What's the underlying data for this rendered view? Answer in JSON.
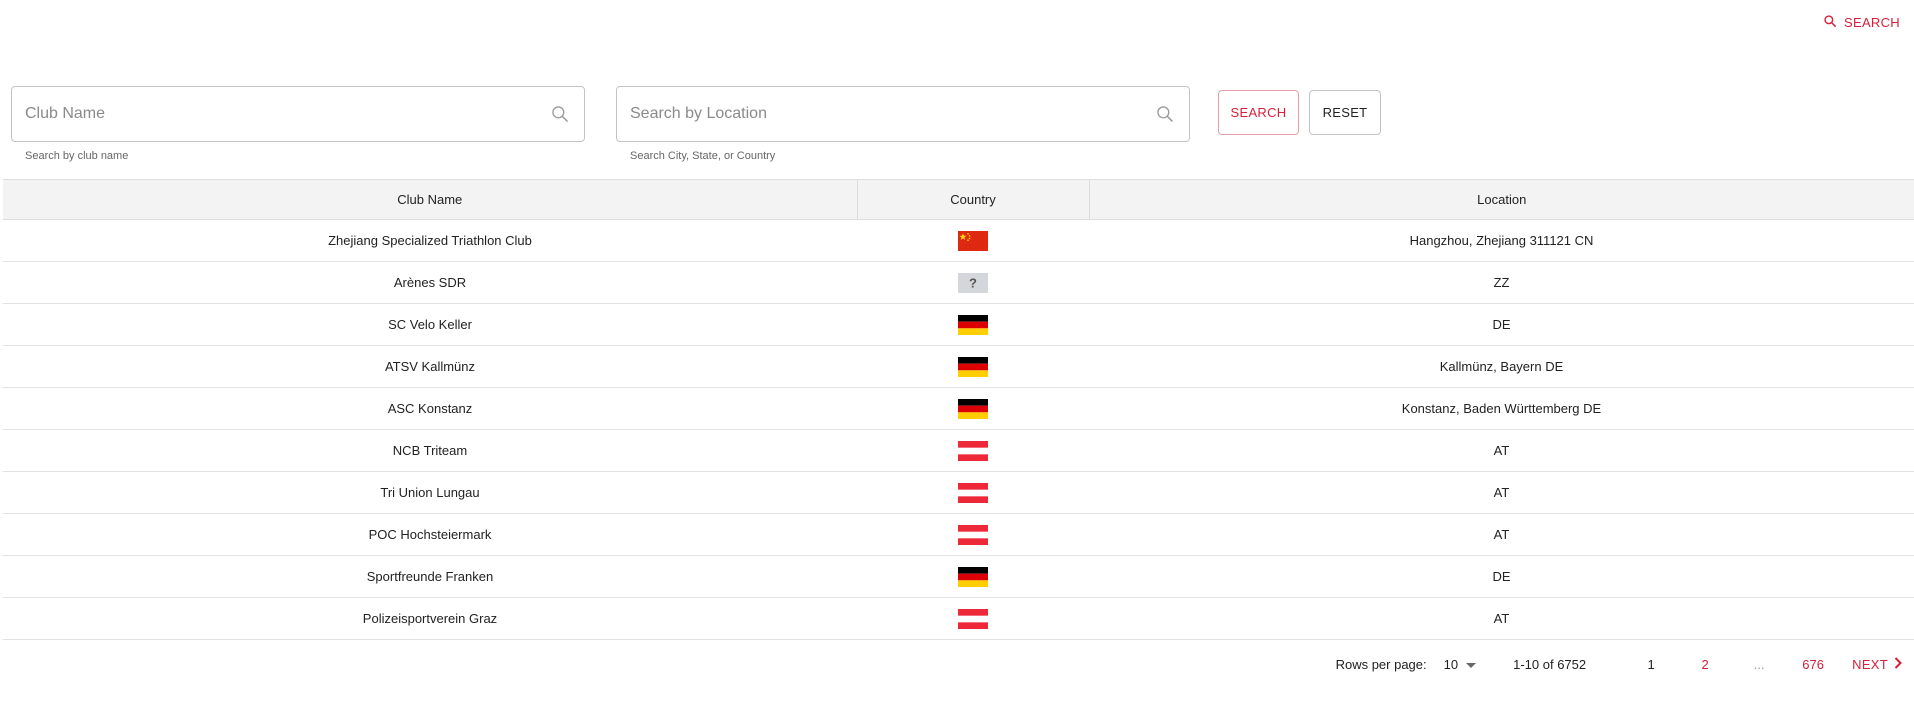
{
  "header": {
    "search_link": "SEARCH",
    "search_icon": "search-icon"
  },
  "filters": {
    "club_name": {
      "placeholder": "Club Name",
      "value": "",
      "helper": "Search by club name"
    },
    "location": {
      "placeholder": "Search by Location",
      "value": "",
      "helper": "Search City, State, or Country"
    },
    "search_button": "SEARCH",
    "reset_button": "RESET"
  },
  "table": {
    "columns": [
      "Club Name",
      "Country",
      "Location"
    ],
    "rows": [
      {
        "club": "Zhejiang Specialized Triathlon Club",
        "flag": "cn",
        "location": "Hangzhou, Zhejiang 311121 CN"
      },
      {
        "club": "Arènes SDR",
        "flag": "unknown",
        "location": "ZZ"
      },
      {
        "club": "SC Velo Keller",
        "flag": "de",
        "location": "DE"
      },
      {
        "club": "ATSV Kallmünz",
        "flag": "de",
        "location": "Kallmünz, Bayern DE"
      },
      {
        "club": "ASC Konstanz",
        "flag": "de",
        "location": "Konstanz, Baden Württemberg DE"
      },
      {
        "club": "NCB Triteam",
        "flag": "at",
        "location": "AT"
      },
      {
        "club": "Tri Union Lungau",
        "flag": "at",
        "location": "AT"
      },
      {
        "club": "POC Hochsteiermark",
        "flag": "at",
        "location": "AT"
      },
      {
        "club": "Sportfreunde Franken",
        "flag": "de",
        "location": "DE"
      },
      {
        "club": "Polizeisportverein Graz",
        "flag": "at",
        "location": "AT"
      }
    ]
  },
  "pagination": {
    "rows_per_page_label": "Rows per page:",
    "rows_per_page": "10",
    "range": "1-10 of 6752",
    "pages": [
      "1",
      "2",
      "...",
      "676"
    ],
    "current_page": "1",
    "next_label": "NEXT"
  },
  "colors": {
    "accent": "#d81e3a",
    "header_bg": "#f3f3f3",
    "border": "#c4c4c4"
  }
}
